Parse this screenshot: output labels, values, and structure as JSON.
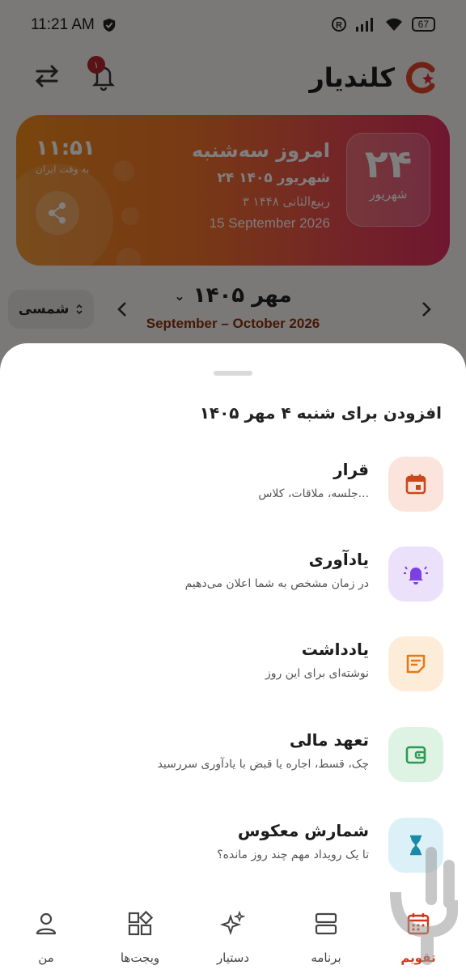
{
  "status_bar": {
    "time": "11:21 AM",
    "battery": "67"
  },
  "header": {
    "app_name": "کلندیار",
    "notification_count": "۱"
  },
  "today_card": {
    "day_number": "۲۴",
    "month_name": "شهریور",
    "title": "امروز سه‌شنبه",
    "jalali_date": "۲۴ شهریور ۱۴۰۵",
    "hijri_date": "۳ ربیع‌الثانی ۱۴۴۸",
    "gregorian_date": "15 September 2026",
    "clock_time": "۱۱:۵۱",
    "clock_caption": "به وقت ایران"
  },
  "month_nav": {
    "calendar_type": "شمسی",
    "month_title": "مهر ۱۴۰۵",
    "month_subtitle": "September – October 2026"
  },
  "sheet": {
    "title": "افزودن برای شنبه ۴ مهر ۱۴۰۵",
    "options": [
      {
        "name": "قرار",
        "desc": "جلسه، ملاقات، کلاس...",
        "icon": "calendar-icon",
        "bg": "#fbe4dc",
        "color": "#c9481f"
      },
      {
        "name": "یادآوری",
        "desc": "در زمان مشخص به شما اعلان می‌دهیم",
        "icon": "bell-ring-icon",
        "bg": "#ece1fb",
        "color": "#7b3fe4"
      },
      {
        "name": "یادداشت",
        "desc": "نوشته‌ای برای این روز",
        "icon": "note-icon",
        "bg": "#fdecd8",
        "color": "#e07b1a"
      },
      {
        "name": "تعهد مالی",
        "desc": "چک، قسط، اجاره یا قبض با یادآوری سررسید",
        "icon": "wallet-icon",
        "bg": "#dff3e4",
        "color": "#2e9a55"
      },
      {
        "name": "شمارش معکوس",
        "desc": "تا یک رویداد مهم چند روز مانده؟",
        "icon": "hourglass-icon",
        "bg": "#dcf1f7",
        "color": "#1a8aa8"
      }
    ]
  },
  "bottom_nav": {
    "items": [
      {
        "label": "من",
        "icon": "person-icon"
      },
      {
        "label": "ویجت‌ها",
        "icon": "widgets-icon"
      },
      {
        "label": "دستیار",
        "icon": "sparkles-icon"
      },
      {
        "label": "برنامه",
        "icon": "schedule-icon"
      },
      {
        "label": "تقویم",
        "icon": "calendar-icon",
        "active": true
      }
    ],
    "active_color": "#d0361a"
  }
}
